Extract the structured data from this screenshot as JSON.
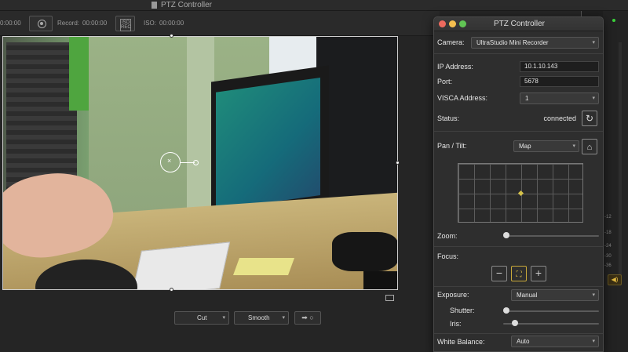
{
  "app": {
    "title": "PTZ Controller"
  },
  "toolbar": {
    "time_left": "0:00:00",
    "record_label": "Record:",
    "record_time": "00:00:00",
    "iso_badge": "ISO\nREC",
    "iso_label": "ISO:",
    "iso_time": "00:00:00"
  },
  "transition": {
    "cut_label": "Cut",
    "smooth_label": "Smooth",
    "arrow_label": "➡ ○"
  },
  "audio": {
    "labels": [
      "-12",
      "-18",
      "-24",
      "-30",
      "-36"
    ],
    "speaker_icon": "speaker-icon"
  },
  "ptz": {
    "title": "PTZ Controller",
    "traffic_lights": [
      "#ed6a5e",
      "#f5bf4f",
      "#61c554"
    ],
    "camera_label": "Camera:",
    "camera_value": "UltraStudio Mini Recorder",
    "ip_label": "IP Address:",
    "ip_value": "10.1.10.143",
    "port_label": "Port:",
    "port_value": "5678",
    "visca_label": "VISCA Address:",
    "visca_value": "1",
    "status_label": "Status:",
    "status_value": "connected",
    "pantilt_label": "Pan / Tilt:",
    "pantilt_mode": "Map",
    "zoom_label": "Zoom:",
    "zoom_level": 0.0,
    "focus_label": "Focus:",
    "focus_minus": "−",
    "focus_plus": "+",
    "exposure_label": "Exposure:",
    "exposure_value": "Manual",
    "shutter_label": "Shutter:",
    "shutter_level": 0.0,
    "iris_label": "Iris:",
    "iris_level": 0.1,
    "wb_label": "White Balance:",
    "wb_value": "Auto"
  }
}
